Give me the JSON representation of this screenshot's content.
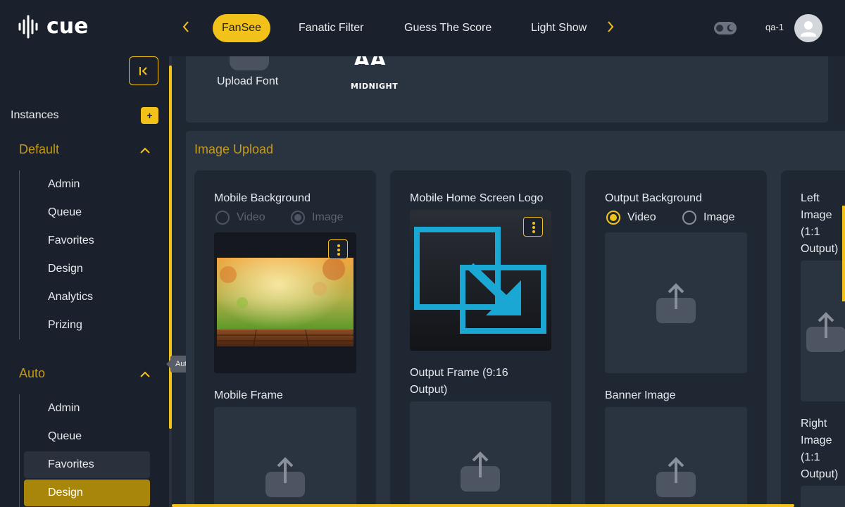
{
  "brand": {
    "logo_text": "cue"
  },
  "header": {
    "tabs": [
      {
        "label": "FanSee",
        "active": true
      },
      {
        "label": "Fanatic Filter",
        "active": false
      },
      {
        "label": "Guess The Score",
        "active": false
      },
      {
        "label": "Light Show",
        "active": false
      }
    ],
    "user_name": "qa-1",
    "theme_toggle": "dark-mode-toggle"
  },
  "sidebar": {
    "instances_label": "Instances",
    "add_label": "+",
    "groups": [
      {
        "title": "Default",
        "expanded": true,
        "items": [
          "Admin",
          "Queue",
          "Favorites",
          "Design",
          "Analytics",
          "Prizing"
        ]
      },
      {
        "title": "Auto",
        "expanded": true,
        "items": [
          "Admin",
          "Queue",
          "Favorites",
          "Design"
        ],
        "active_item": "Design",
        "hover_item": "Favorites"
      }
    ],
    "tooltip": "Auto"
  },
  "fonts_panel": {
    "upload_font_label": "Upload Font",
    "font_preview_glyph": "AA",
    "font_name": "Midnight"
  },
  "image_upload": {
    "title": "Image Upload",
    "cards": [
      {
        "label": "Mobile Background",
        "radio_options": [
          "Video",
          "Image"
        ],
        "selected": "Image",
        "disabled": true,
        "second_label": "Mobile Frame"
      },
      {
        "label": "Mobile Home Screen Logo",
        "second_label": "Output Frame (9:16 Output)"
      },
      {
        "label": "Output Background",
        "radio_options": [
          "Video",
          "Image"
        ],
        "selected": "Video",
        "disabled": false,
        "second_label": "Banner Image"
      },
      {
        "label": "Left Image (1:1 Output)",
        "second_label": "Right Image (1:1 Output)"
      }
    ]
  },
  "colors": {
    "accent": "#f2c21b",
    "section_title": "#c79a14",
    "active_item": "#a8860a",
    "background": "#1f2733",
    "panel": "#2a3340",
    "logo_blue": "#1aa7d4"
  }
}
